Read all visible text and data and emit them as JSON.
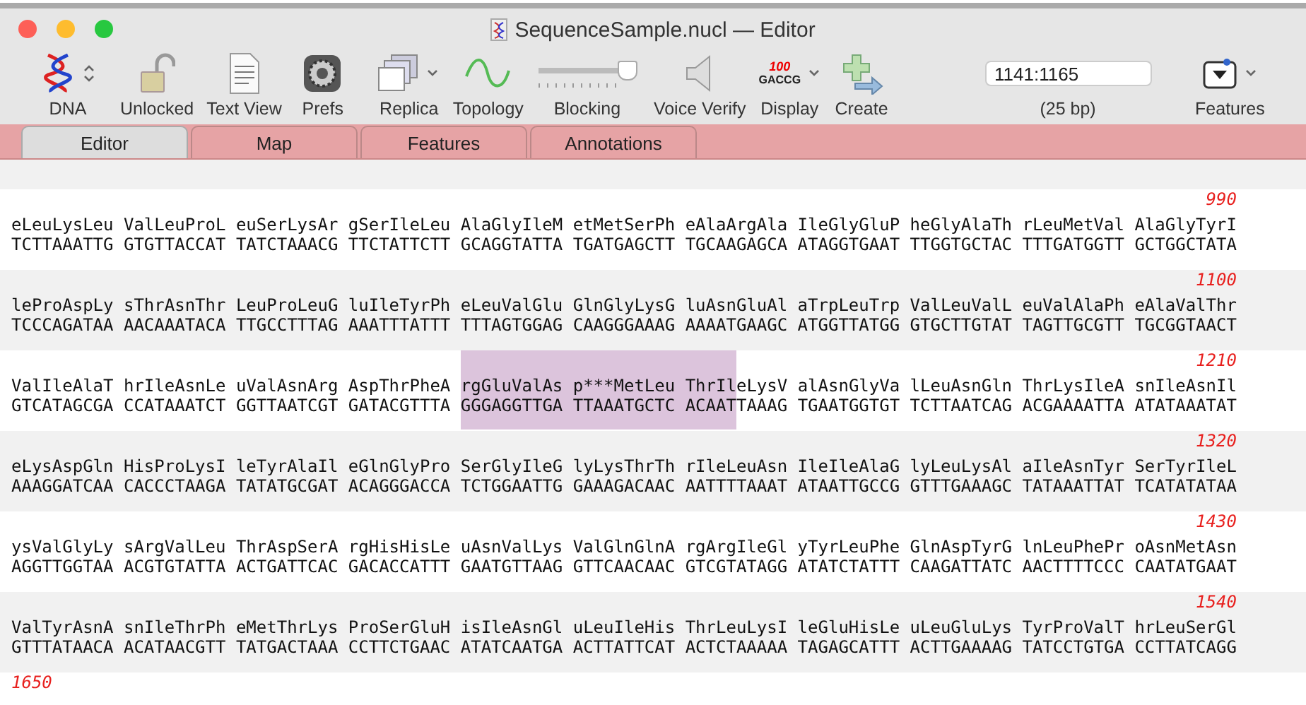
{
  "window": {
    "title": "SequenceSample.nucl — Editor"
  },
  "toolbar": {
    "items": [
      {
        "kind": "dna",
        "label": "DNA",
        "stepper": true
      },
      {
        "kind": "lock",
        "label": "Unlocked"
      },
      {
        "kind": "document",
        "label": "Text View"
      },
      {
        "kind": "prefs",
        "label": "Prefs"
      },
      {
        "kind": "replica",
        "label": "Replica",
        "menu": true
      },
      {
        "kind": "topology",
        "label": "Topology"
      },
      {
        "kind": "slider",
        "label": "Blocking",
        "level": 0.9
      },
      {
        "kind": "speaker",
        "label": "Voice Verify"
      },
      {
        "kind": "display",
        "label": "Display",
        "menu": true,
        "badge": "100",
        "code": "GACCG"
      },
      {
        "kind": "create",
        "label": "Create"
      },
      {
        "kind": "field",
        "value": "1141:1165",
        "label": "(25 bp)"
      },
      {
        "kind": "features",
        "label": "Features",
        "menu": true
      }
    ]
  },
  "tabs": [
    {
      "label": "Editor",
      "selected": true
    },
    {
      "label": "Map",
      "selected": false
    },
    {
      "label": "Features",
      "selected": false
    },
    {
      "label": "Annotations",
      "selected": false
    }
  ],
  "sequence": {
    "blocks": [
      {
        "number": "990",
        "lines": [
          {
            "kind": "protein",
            "segments": [
              {
                "text": "eLeuLysLeu ValLeuProL euSerLysAr gSerIleLeu AlaGlyIleM etMetSerPh eAlaArgAla IleGlyGluP heGlyAlaTh rLeuMetVal AlaGlyTyrI",
                "selected": false
              }
            ]
          },
          {
            "kind": "dna",
            "segments": [
              {
                "text": "TCTTAAATTG GTGTTACCAT TATCTAAACG TTCTATTCTT GCAGGTATTA TGATGAGCTT TGCAAGAGCA ATAGGTGAAT TTGGTGCTAC TTTGATGGTT GCTGGCTATA",
                "selected": false
              }
            ]
          }
        ]
      },
      {
        "number": "1100",
        "lines": [
          {
            "kind": "protein",
            "segments": [
              {
                "text": "leProAspLy sThrAsnThr LeuProLeuG luIleTyrPh eLeuValGlu GlnGlyLysG luAsnGluAl aTrpLeuTrp ValLeuValL euValAlaPh eAlaValThr",
                "selected": false
              }
            ]
          },
          {
            "kind": "dna",
            "segments": [
              {
                "text": "TCCCAGATAA AACAAATACA TTGCCTTTAG AAATTTATTT TTTAGTGGAG CAAGGGAAAG AAAATGAAGC ATGGTTATGG GTGCTTGTAT TAGTTGCGTT TGCGGTAACT",
                "selected": false
              }
            ]
          }
        ]
      },
      {
        "number": "1210",
        "lines": [
          {
            "kind": "protein",
            "segments": [
              {
                "text": "ValIleAlaT hrIleAsnLe uValAsnArg AspThrPheA ",
                "selected": false
              },
              {
                "text": "rgGluValAs p***MetLeu ThrIl",
                "selected": true
              },
              {
                "text": "eLysV alAsnGlyVa lLeuAsnGln ThrLysIleA snIleAsnIl",
                "selected": false
              }
            ]
          },
          {
            "kind": "dna",
            "segments": [
              {
                "text": "GTCATAGCGA CCATAAATCT GGTTAATCGT GATACGTTTA ",
                "selected": false
              },
              {
                "text": "GGGAGGTTGA TTAAATGCTC ACAAT",
                "selected": true
              },
              {
                "text": "TAAAG TGAATGGTGT TCTTAATCAG ACGAAAATTA ATATAAATAT",
                "selected": false
              }
            ]
          }
        ]
      },
      {
        "number": "1320",
        "lines": [
          {
            "kind": "protein",
            "segments": [
              {
                "text": "eLysAspGln HisProLysI leTyrAlaIl eGlnGlyPro SerGlyIleG lyLysThrTh rIleLeuAsn IleIleAlaG lyLeuLysAl aIleAsnTyr SerTyrIleL",
                "selected": false
              }
            ]
          },
          {
            "kind": "dna",
            "segments": [
              {
                "text": "AAAGGATCAA CACCCTAAGA TATATGCGAT ACAGGGACCA TCTGGAATTG GAAAGACAAC AATTTTAAAT ATAATTGCCG GTTTGAAAGC TATAAATTAT TCATATATAA",
                "selected": false
              }
            ]
          }
        ]
      },
      {
        "number": "1430",
        "lines": [
          {
            "kind": "protein",
            "segments": [
              {
                "text": "ysValGlyLy sArgValLeu ThrAspSerA rgHisHisLe uAsnValLys ValGlnGlnA rgArgIleGl yTyrLeuPhe GlnAspTyrG lnLeuPhePr oAsnMetAsn",
                "selected": false
              }
            ]
          },
          {
            "kind": "dna",
            "segments": [
              {
                "text": "AGGTTGGTAA ACGTGTATTA ACTGATTCAC GACACCATTT GAATGTTAAG GTTCAACAAC GTCGTATAGG ATATCTATTT CAAGATTATC AACTTTTCCC CAATATGAAT",
                "selected": false
              }
            ]
          }
        ]
      },
      {
        "number": "1540",
        "lines": [
          {
            "kind": "protein",
            "segments": [
              {
                "text": "ValTyrAsnA snIleThrPh eMetThrLys ProSerGluH isIleAsnGl uLeuIleHis ThrLeuLysI leGluHisLe uLeuGluLys TyrProValT hrLeuSerGl",
                "selected": false
              }
            ]
          },
          {
            "kind": "dna",
            "segments": [
              {
                "text": "GTTTATAACA ACATAACGTT TATGACTAAA CCTTCTGAAC ATATCAATGA ACTTATTCAT ACTCTAAAAA TAGAGCATTT ACTTGAAAAG TATCCTGTGA CCTTATCAGG",
                "selected": false
              }
            ]
          }
        ]
      },
      {
        "number": "1650"
      }
    ]
  }
}
